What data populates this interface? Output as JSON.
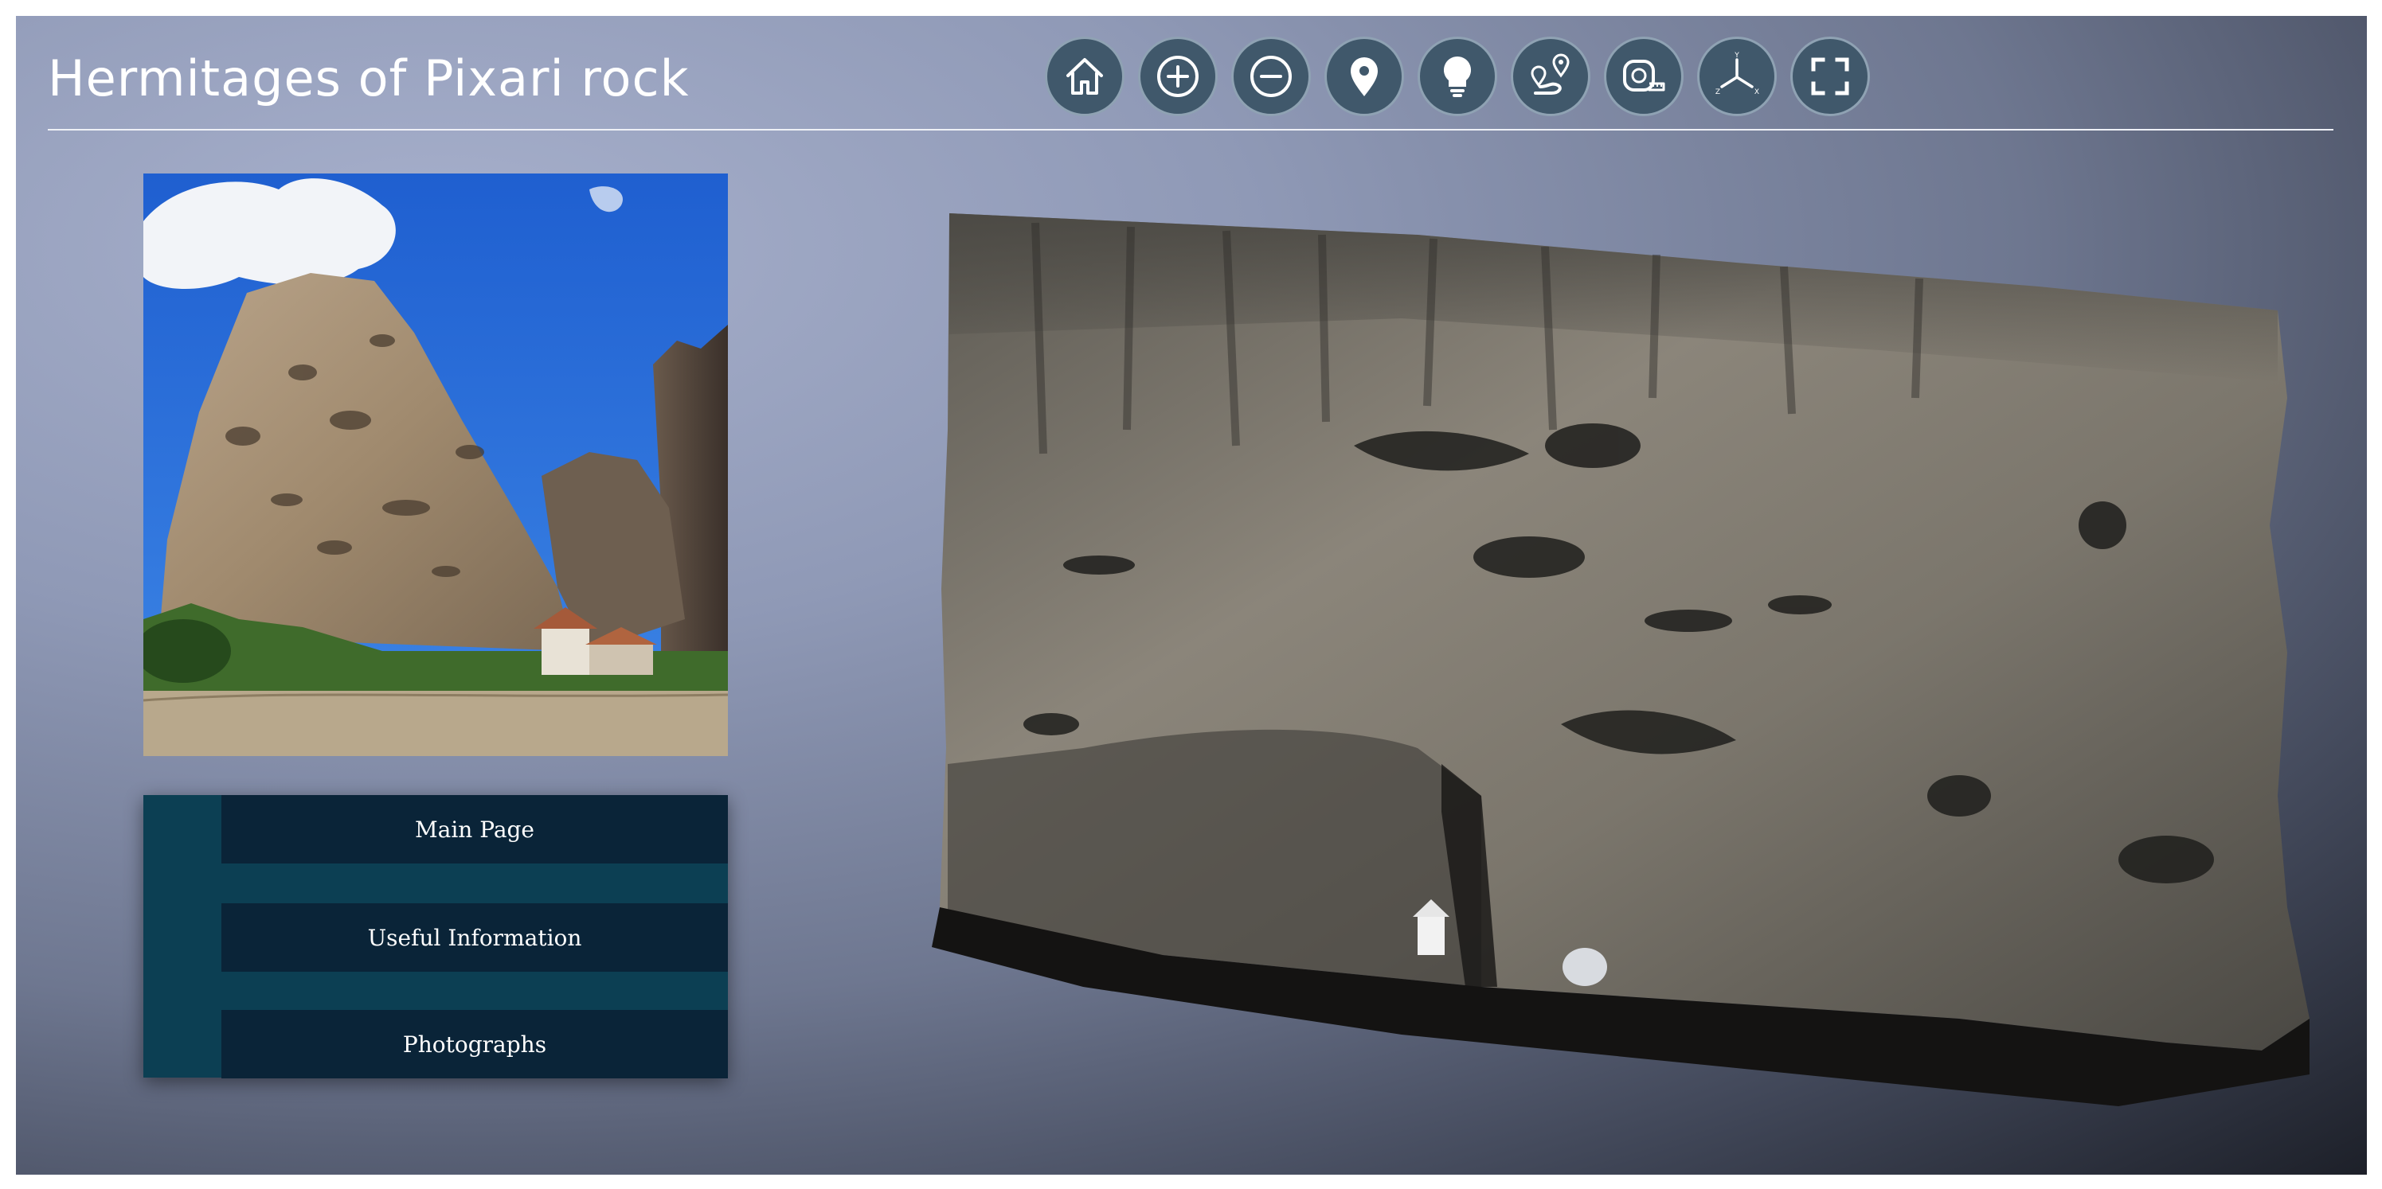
{
  "app": {
    "title": "Hermitages of Pixari rock"
  },
  "toolbar": {
    "buttons": [
      {
        "icon": "home-icon"
      },
      {
        "icon": "zoom-in-icon"
      },
      {
        "icon": "zoom-out-icon"
      },
      {
        "icon": "map-pin-icon"
      },
      {
        "icon": "lightbulb-icon"
      },
      {
        "icon": "route-pin-icon"
      },
      {
        "icon": "tape-measure-icon"
      },
      {
        "icon": "axes-icon"
      },
      {
        "icon": "fullscreen-icon"
      }
    ],
    "axes": {
      "y": "Y",
      "z": "Z",
      "x": "X"
    }
  },
  "menu": {
    "items": [
      {
        "label": "Main Page"
      },
      {
        "label": "Useful Information"
      },
      {
        "label": "Photographs"
      }
    ]
  },
  "colors": {
    "toolbar_button": "#40586b",
    "menu_panel": "#0c3f53",
    "menu_item": "#0a2438"
  }
}
